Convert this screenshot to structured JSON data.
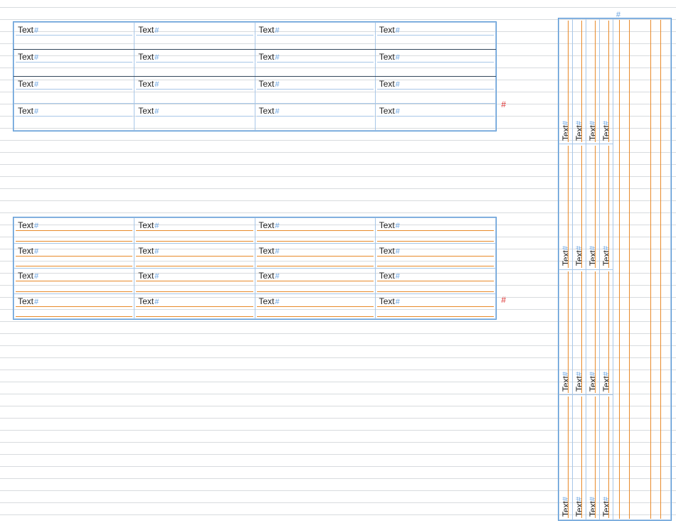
{
  "cell_label": "Text",
  "hidden_char": "#",
  "overset_mark": "#",
  "anchor_mark": "#",
  "tables": {
    "table1": {
      "rows": 4,
      "cols": 4,
      "style": "blue"
    },
    "table2": {
      "rows": 4,
      "cols": 4,
      "style": "orange"
    },
    "table3_rotated": {
      "rows": 4,
      "cols": 4,
      "style": "orange-vertical"
    }
  }
}
